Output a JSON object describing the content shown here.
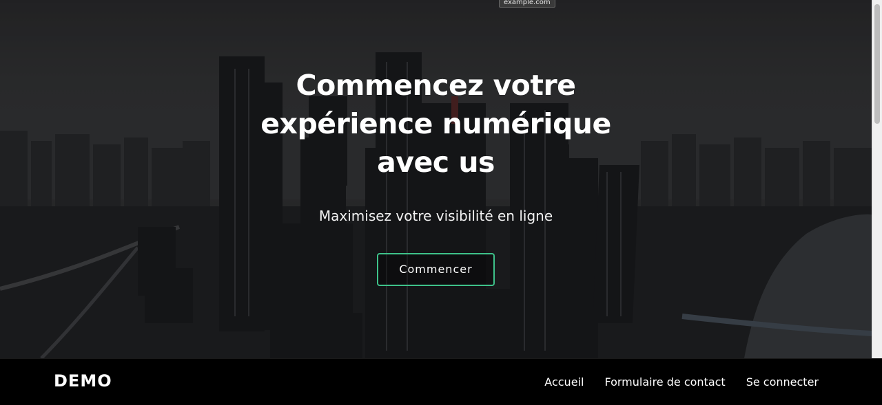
{
  "tooltip": {
    "url": "example.com"
  },
  "hero": {
    "title": "Commencez votre expérience numérique avec us",
    "subtitle": "Maximisez votre visibilité en ligne",
    "cta_label": "Commencer",
    "accent_color": "#3ec28a",
    "background": "aerial-city-skyline-image"
  },
  "navbar": {
    "brand": "DEMO",
    "links": [
      {
        "label": "Accueil"
      },
      {
        "label": "Formulaire de contact"
      },
      {
        "label": "Se connecter"
      }
    ]
  }
}
